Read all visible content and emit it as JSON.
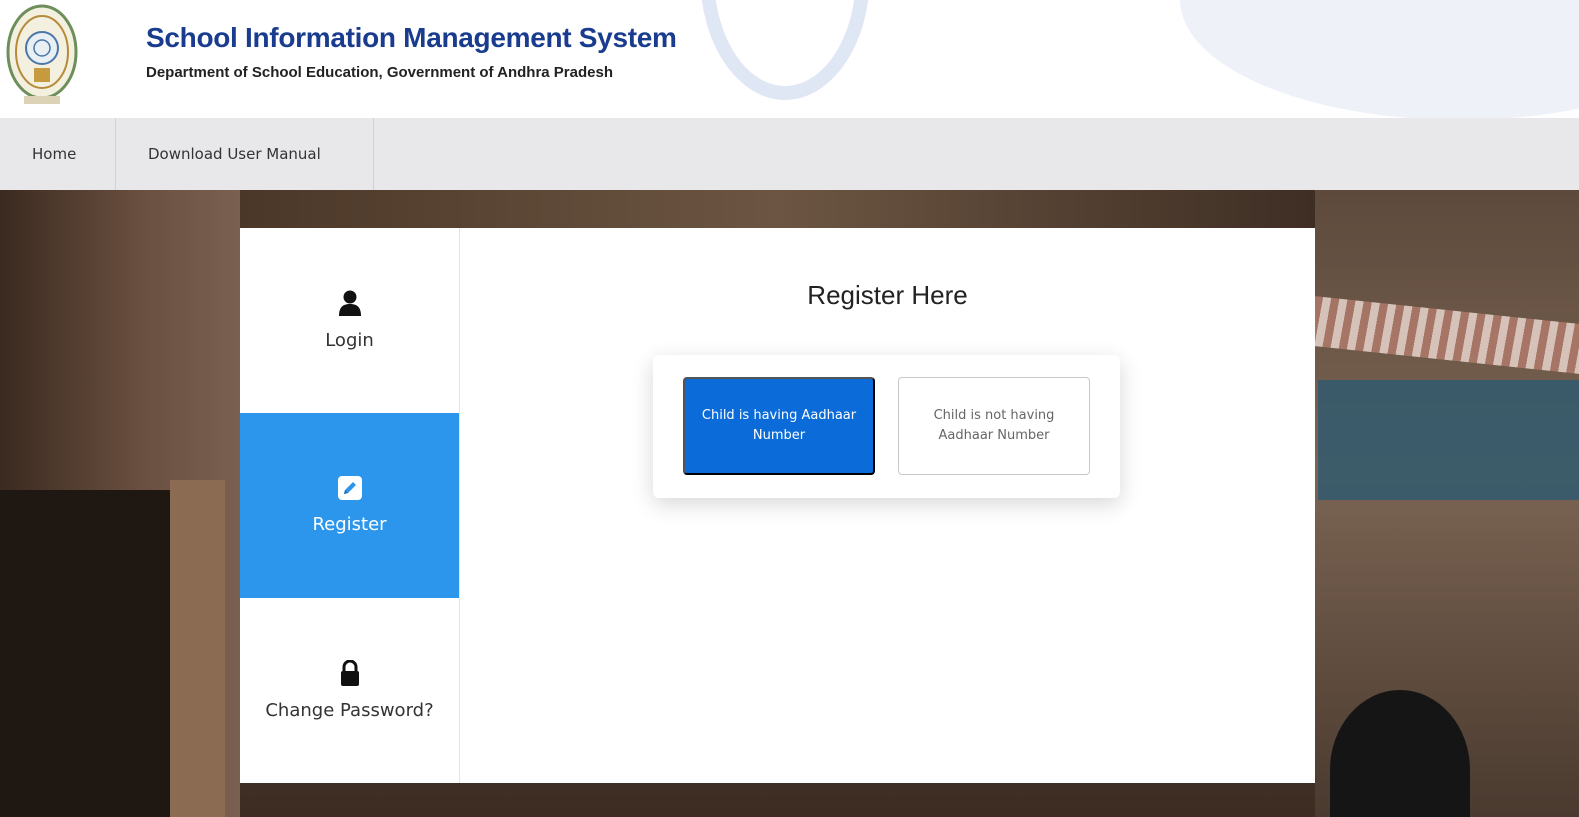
{
  "header": {
    "title": "School Information Management System",
    "subtitle": "Department of School Education, Government of Andhra Pradesh"
  },
  "nav": {
    "items": [
      {
        "label": "Home"
      },
      {
        "label": "Download User Manual"
      }
    ]
  },
  "side": {
    "items": [
      {
        "label": "Login",
        "icon": "user-icon",
        "active": false
      },
      {
        "label": "Register",
        "icon": "pencil-icon",
        "active": true
      },
      {
        "label": "Change Password?",
        "icon": "lock-icon",
        "active": false
      }
    ]
  },
  "main": {
    "heading": "Register Here",
    "choices": {
      "with_aadhaar": "Child is having Aadhaar Number",
      "without_aadhaar": "Child is not having Aadhaar Number"
    }
  },
  "colors": {
    "brand_title": "#1a3c8f",
    "active_tab": "#2b96ec",
    "primary_button": "#0b6bd8"
  }
}
